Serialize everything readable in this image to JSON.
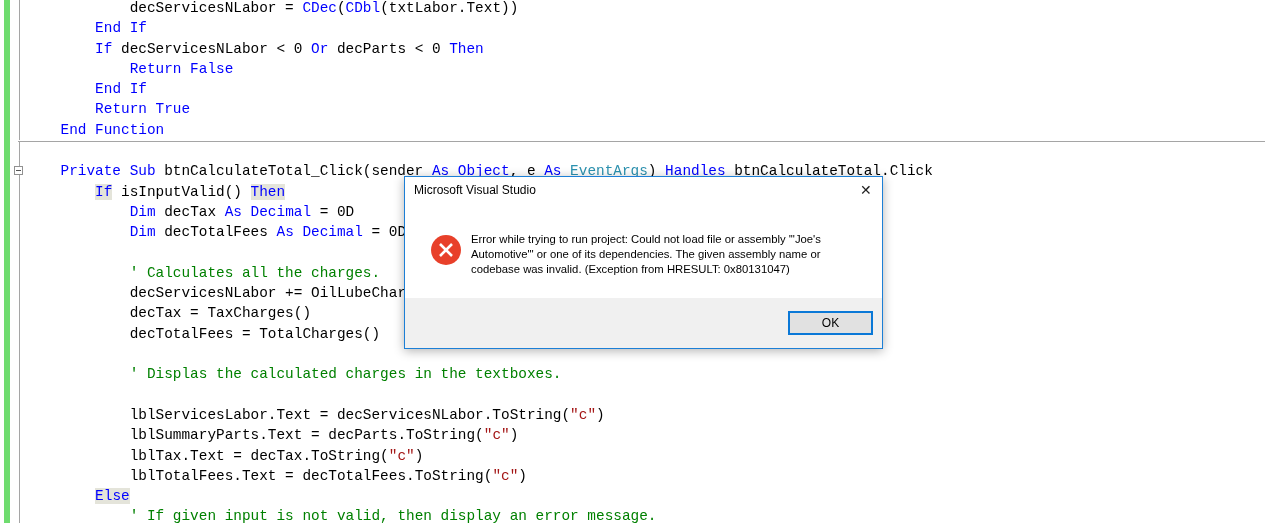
{
  "editor": {
    "lines": [
      {
        "kind": "block",
        "children": [
          {
            "kind": "block",
            "children": [
              {
                "kind": "code",
                "foldable": false,
                "tokens": [
                  {
                    "kind": "plain",
                    "text": "decServicesNLabor = "
                  },
                  {
                    "kind": "keyword",
                    "text": "CDec"
                  },
                  {
                    "kind": "plain",
                    "text": "("
                  },
                  {
                    "kind": "keyword",
                    "text": "CDbl"
                  },
                  {
                    "kind": "plain",
                    "text": "(txtLabor.Text))"
                  }
                ]
              }
            ]
          },
          {
            "kind": "code",
            "foldable": false,
            "tokens": [
              {
                "kind": "keyword",
                "text": "End If"
              }
            ]
          },
          {
            "kind": "code",
            "foldable": false,
            "tokens": [
              {
                "kind": "keyword",
                "text": "If"
              },
              {
                "kind": "plain",
                "text": " decServicesNLabor < 0 "
              },
              {
                "kind": "keyword",
                "text": "Or"
              },
              {
                "kind": "plain",
                "text": " decParts < 0 "
              },
              {
                "kind": "keyword",
                "text": "Then"
              }
            ]
          },
          {
            "kind": "block",
            "children": [
              {
                "kind": "code",
                "foldable": false,
                "tokens": [
                  {
                    "kind": "keyword",
                    "text": "Return False"
                  }
                ]
              }
            ]
          },
          {
            "kind": "code",
            "foldable": false,
            "tokens": [
              {
                "kind": "keyword",
                "text": "End If"
              }
            ]
          },
          {
            "kind": "code",
            "foldable": false,
            "tokens": [
              {
                "kind": "keyword",
                "text": "Return True"
              }
            ]
          }
        ]
      },
      {
        "kind": "code",
        "foldable": false,
        "tokens": [
          {
            "kind": "keyword",
            "text": "End Function"
          }
        ]
      },
      {
        "kind": "divider"
      },
      {
        "kind": "blank"
      },
      {
        "kind": "code",
        "foldable": true,
        "tokens": [
          {
            "kind": "keyword",
            "text": "Private Sub"
          },
          {
            "kind": "plain",
            "text": " btnCalculateTotal_Click(sender "
          },
          {
            "kind": "keyword",
            "text": "As Object"
          },
          {
            "kind": "plain",
            "text": ", e "
          },
          {
            "kind": "keyword",
            "text": "As"
          },
          {
            "kind": "type",
            "text": " EventArgs"
          },
          {
            "kind": "plain",
            "text": ") "
          },
          {
            "kind": "keyword",
            "text": "Handles"
          },
          {
            "kind": "plain",
            "text": " btnCalculateTotal.Click"
          }
        ]
      },
      {
        "kind": "block",
        "children": [
          {
            "kind": "code",
            "foldable": false,
            "tokens": [
              {
                "kind": "match",
                "text": "If"
              },
              {
                "kind": "plain",
                "text": " isInputValid() "
              },
              {
                "kind": "match",
                "text": "Then"
              }
            ]
          },
          {
            "kind": "block",
            "children": [
              {
                "kind": "code",
                "foldable": false,
                "tokens": [
                  {
                    "kind": "keyword",
                    "text": "Dim"
                  },
                  {
                    "kind": "plain",
                    "text": " decTax "
                  },
                  {
                    "kind": "keyword",
                    "text": "As Decimal"
                  },
                  {
                    "kind": "plain",
                    "text": " = 0D"
                  }
                ]
              },
              {
                "kind": "code",
                "foldable": false,
                "tokens": [
                  {
                    "kind": "keyword",
                    "text": "Dim"
                  },
                  {
                    "kind": "plain",
                    "text": " decTotalFees "
                  },
                  {
                    "kind": "keyword",
                    "text": "As Decimal"
                  },
                  {
                    "kind": "plain",
                    "text": " = 0D"
                  }
                ]
              },
              {
                "kind": "blank"
              },
              {
                "kind": "code",
                "foldable": false,
                "tokens": [
                  {
                    "kind": "comment",
                    "text": "' Calculates all the charges."
                  }
                ]
              },
              {
                "kind": "code",
                "foldable": false,
                "tokens": [
                  {
                    "kind": "plain",
                    "text": "decServicesNLabor += OilLubeChar"
                  }
                ]
              },
              {
                "kind": "code",
                "foldable": false,
                "tokens": [
                  {
                    "kind": "plain",
                    "text": "decTax = TaxCharges()"
                  }
                ]
              },
              {
                "kind": "code",
                "foldable": false,
                "tokens": [
                  {
                    "kind": "plain",
                    "text": "decTotalFees = TotalCharges()"
                  }
                ]
              },
              {
                "kind": "blank"
              },
              {
                "kind": "code",
                "foldable": false,
                "tokens": [
                  {
                    "kind": "comment",
                    "text": "' Displas the calculated charges in the textboxes."
                  }
                ]
              },
              {
                "kind": "blank"
              },
              {
                "kind": "code",
                "foldable": false,
                "tokens": [
                  {
                    "kind": "plain",
                    "text": "lblServicesLabor.Text = decServicesNLabor.ToString("
                  },
                  {
                    "kind": "string",
                    "text": "\"c\""
                  },
                  {
                    "kind": "plain",
                    "text": ")"
                  }
                ]
              },
              {
                "kind": "code",
                "foldable": false,
                "tokens": [
                  {
                    "kind": "plain",
                    "text": "lblSummaryParts.Text = decParts.ToString("
                  },
                  {
                    "kind": "string",
                    "text": "\"c\""
                  },
                  {
                    "kind": "plain",
                    "text": ")"
                  }
                ]
              },
              {
                "kind": "code",
                "foldable": false,
                "tokens": [
                  {
                    "kind": "plain",
                    "text": "lblTax.Text = decTax.ToString("
                  },
                  {
                    "kind": "string",
                    "text": "\"c\""
                  },
                  {
                    "kind": "plain",
                    "text": ")"
                  }
                ]
              },
              {
                "kind": "code",
                "foldable": false,
                "tokens": [
                  {
                    "kind": "plain",
                    "text": "lblTotalFees.Text = decTotalFees.ToString("
                  },
                  {
                    "kind": "string",
                    "text": "\"c\""
                  },
                  {
                    "kind": "plain",
                    "text": ")"
                  }
                ]
              }
            ]
          },
          {
            "kind": "code",
            "foldable": false,
            "tokens": [
              {
                "kind": "match",
                "text": "Else"
              }
            ]
          },
          {
            "kind": "block",
            "children": [
              {
                "kind": "code",
                "foldable": false,
                "tokens": [
                  {
                    "kind": "comment",
                    "text": "' If given input is not valid, then display an error message."
                  }
                ]
              }
            ]
          }
        ]
      }
    ]
  },
  "dialog": {
    "title": "Microsoft Visual Studio",
    "close": "✕",
    "message": "Error while trying to run project: Could not load file or assembly '\"Joe's Automotive\"' or one of its dependencies. The given assembly name or codebase was invalid. (Exception from HRESULT: 0x80131047)",
    "buttons": [
      "OK"
    ]
  }
}
